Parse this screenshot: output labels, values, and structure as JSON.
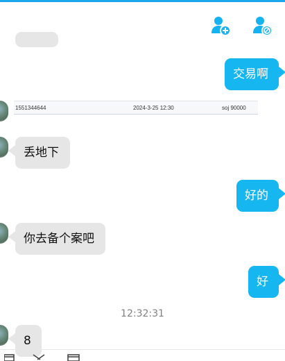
{
  "header": {
    "add_user_icon": "add-user-icon",
    "block_user_icon": "block-user-icon",
    "accent": "#1aa7ec"
  },
  "messages": [
    {
      "side": "left",
      "text": ""
    },
    {
      "side": "right",
      "text": "交易啊"
    },
    {
      "side": "left",
      "type": "table",
      "cells": [
        "1551344644",
        "2024-3-25 12:30",
        "soj 90000"
      ]
    },
    {
      "side": "left",
      "text": "丢地下"
    },
    {
      "side": "right",
      "text": "好的"
    },
    {
      "side": "left",
      "text": "你去备个案吧"
    },
    {
      "side": "right",
      "text": "好"
    },
    {
      "type": "time",
      "text": "12:32:31"
    },
    {
      "side": "left",
      "text": "8"
    }
  ]
}
